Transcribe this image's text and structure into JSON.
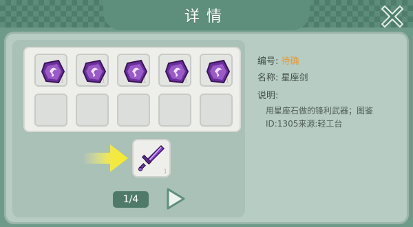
{
  "header": {
    "title": "详情"
  },
  "info": {
    "number_label": "编号:",
    "number_value": "待确",
    "name_label": "名称:",
    "name_value": "星座剑",
    "desc_label": "说明:",
    "desc_text": "用星座石做的锋利武器；图鉴ID:1305来源:轻工台"
  },
  "materials": [
    {
      "icon": "constellation-stone-icon",
      "count": "1"
    },
    {
      "icon": "constellation-stone-icon",
      "count": "1"
    },
    {
      "icon": "constellation-stone-icon",
      "count": "1"
    },
    {
      "icon": "constellation-stone-icon",
      "count": "1"
    },
    {
      "icon": "constellation-stone-icon",
      "count": "1"
    }
  ],
  "result": {
    "icon": "constellation-sword-icon",
    "count": "1"
  },
  "pager": {
    "text": "1/4"
  },
  "colors": {
    "accent_orange": "#e39a3b",
    "arrow_yellow": "#f2e94a",
    "panel": "#b7ccc3"
  }
}
